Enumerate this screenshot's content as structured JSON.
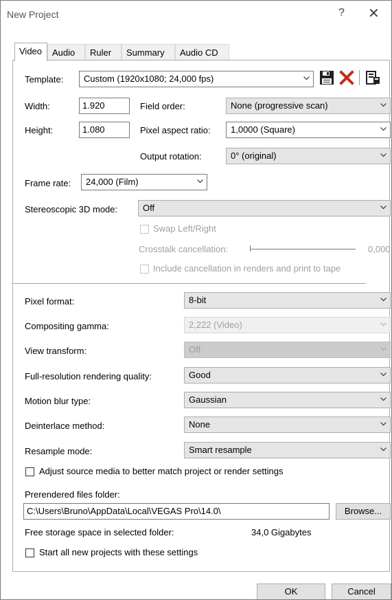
{
  "window": {
    "title": "New Project",
    "help_glyph": "?",
    "close_glyph": "✕"
  },
  "tabs": [
    {
      "label": "Video",
      "active": true
    },
    {
      "label": "Audio"
    },
    {
      "label": "Ruler"
    },
    {
      "label": "Summary"
    },
    {
      "label": "Audio CD"
    }
  ],
  "template": {
    "label": "Template:",
    "value": "Custom (1920x1080; 24,000 fps)"
  },
  "width": {
    "label": "Width:",
    "value": "1.920"
  },
  "height": {
    "label": "Height:",
    "value": "1.080"
  },
  "field_order": {
    "label": "Field order:",
    "value": "None (progressive scan)"
  },
  "pixel_aspect": {
    "label": "Pixel aspect ratio:",
    "value": "1,0000 (Square)"
  },
  "output_rotation": {
    "label": "Output rotation:",
    "value": "0° (original)"
  },
  "frame_rate": {
    "label": "Frame rate:",
    "value": "24,000 (Film)"
  },
  "stereo": {
    "label": "Stereoscopic 3D mode:",
    "value": "Off",
    "swap_label": "Swap Left/Right",
    "crosstalk_label": "Crosstalk cancellation:",
    "crosstalk_value": "0,000",
    "include_label": "Include cancellation in renders and print to tape"
  },
  "pixel_format": {
    "label": "Pixel format:",
    "value": "8-bit"
  },
  "compositing_gamma": {
    "label": "Compositing gamma:",
    "value": "2,222 (Video)"
  },
  "view_transform": {
    "label": "View transform:",
    "value": "Off"
  },
  "render_quality": {
    "label": "Full-resolution rendering quality:",
    "value": "Good"
  },
  "motion_blur": {
    "label": "Motion blur type:",
    "value": "Gaussian"
  },
  "deinterlace": {
    "label": "Deinterlace method:",
    "value": "None"
  },
  "resample": {
    "label": "Resample mode:",
    "value": "Smart resample"
  },
  "adjust_source": {
    "label": "Adjust source media to better match project or render settings",
    "checked": false
  },
  "prerender": {
    "label": "Prerendered files folder:",
    "path": "C:\\Users\\Bruno\\AppData\\Local\\VEGAS Pro\\14.0\\",
    "browse_label": "Browse..."
  },
  "storage": {
    "label": "Free storage space in selected folder:",
    "value": "34,0 Gigabytes"
  },
  "start_all": {
    "label": "Start all new projects with these settings",
    "checked": false
  },
  "buttons": {
    "ok": "OK",
    "cancel": "Cancel"
  },
  "icons": {
    "save": "save-icon",
    "delete": "delete-icon",
    "properties": "properties-icon"
  },
  "colors": {
    "delete_red": "#c42b1c",
    "disabled_text": "#a0a0a0",
    "dropdown_bg": "#e5e5e5"
  }
}
